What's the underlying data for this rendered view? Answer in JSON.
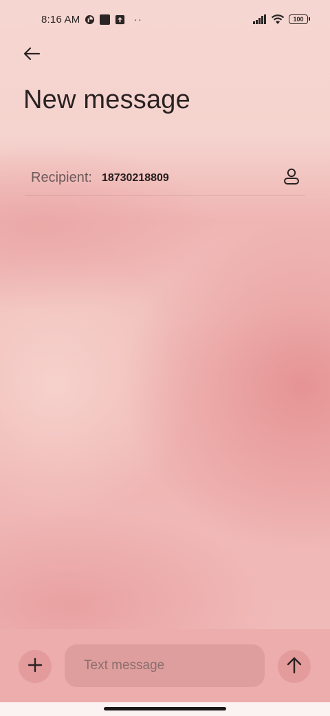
{
  "status_bar": {
    "time": "8:16 AM",
    "battery": "100",
    "icons": [
      "data-saver-icon",
      "app-notification-icon",
      "upload-icon",
      "more-dots-icon",
      "signal-icon",
      "wifi-icon",
      "battery-icon"
    ]
  },
  "header": {
    "back_icon": "arrow-left-icon",
    "title": "New message"
  },
  "recipient": {
    "label": "Recipient:",
    "value": "18730218809",
    "contact_icon": "person-icon"
  },
  "composer": {
    "add_icon": "plus-icon",
    "placeholder": "Text message",
    "value": "",
    "send_icon": "arrow-up-icon"
  },
  "colors": {
    "composer_bg": "#ecadac",
    "button_bg": "#e39b9b",
    "input_bg": "#de9e9d",
    "text": "#2a2222"
  }
}
